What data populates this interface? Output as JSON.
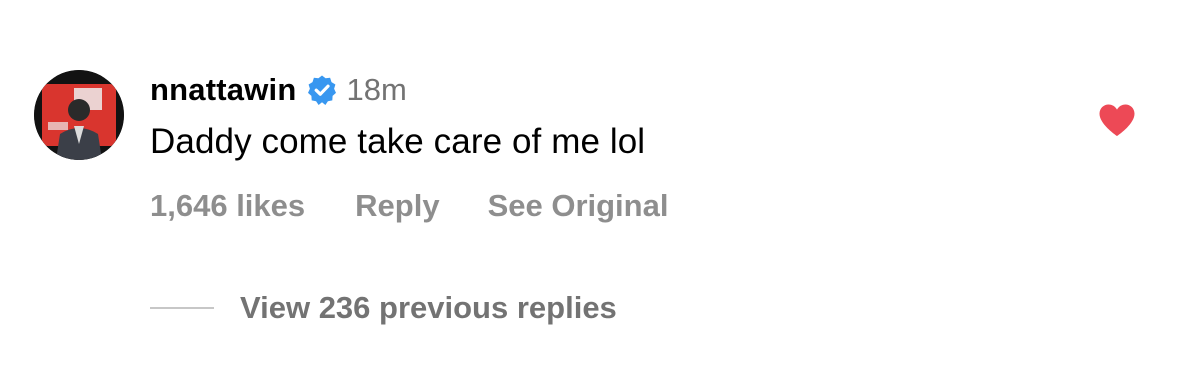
{
  "comment": {
    "username": "nnattawin",
    "verified_icon": "verified-badge-icon",
    "timestamp": "18m",
    "text": "Daddy come take care of me lol",
    "liked": true,
    "heart_icon": "heart-filled-icon",
    "actions": {
      "likes": "1,646 likes",
      "reply": "Reply",
      "see_original": "See Original"
    },
    "replies": {
      "label": "View 236 previous replies"
    }
  },
  "colors": {
    "verified_blue": "#3897f0",
    "heart_red": "#ed4956",
    "secondary_text": "#737373",
    "action_text": "#8e8e8e",
    "divider": "#c7c7c7"
  }
}
